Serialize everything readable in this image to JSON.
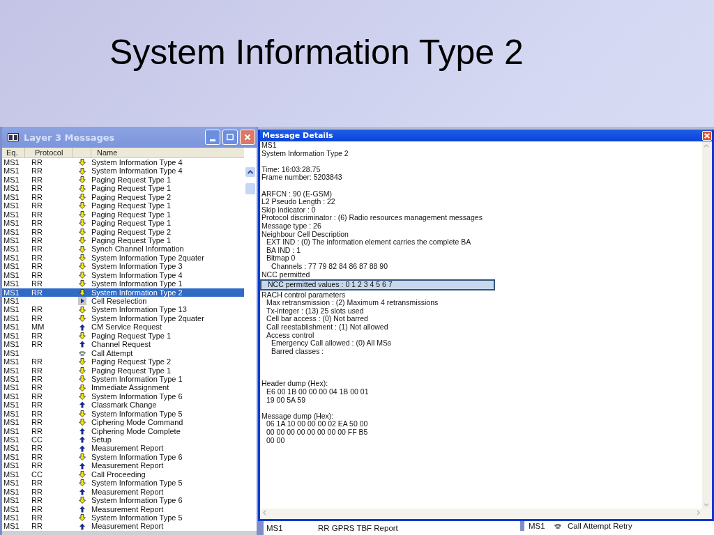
{
  "slide_title": "System Information Type 2",
  "messages_window": {
    "title": "Layer 3 Messages",
    "columns": [
      "Eq.",
      "Protocol",
      "Name"
    ],
    "rows": [
      {
        "eq": "MS1",
        "protocol": "RR",
        "kind": "down",
        "name": "System Information Type 4",
        "selected": false
      },
      {
        "eq": "MS1",
        "protocol": "RR",
        "kind": "down",
        "name": "System Information Type 4",
        "selected": false
      },
      {
        "eq": "MS1",
        "protocol": "RR",
        "kind": "down",
        "name": "Paging Request Type 1",
        "selected": false
      },
      {
        "eq": "MS1",
        "protocol": "RR",
        "kind": "down",
        "name": "Paging Request Type 1",
        "selected": false
      },
      {
        "eq": "MS1",
        "protocol": "RR",
        "kind": "down",
        "name": "Paging Request Type 2",
        "selected": false
      },
      {
        "eq": "MS1",
        "protocol": "RR",
        "kind": "down",
        "name": "Paging Request Type 1",
        "selected": false
      },
      {
        "eq": "MS1",
        "protocol": "RR",
        "kind": "down",
        "name": "Paging Request Type 1",
        "selected": false
      },
      {
        "eq": "MS1",
        "protocol": "RR",
        "kind": "down",
        "name": "Paging Request Type 1",
        "selected": false
      },
      {
        "eq": "MS1",
        "protocol": "RR",
        "kind": "down",
        "name": "Paging Request Type 2",
        "selected": false
      },
      {
        "eq": "MS1",
        "protocol": "RR",
        "kind": "down",
        "name": "Paging Request Type 1",
        "selected": false
      },
      {
        "eq": "MS1",
        "protocol": "RR",
        "kind": "down",
        "name": "Synch Channel Information",
        "selected": false
      },
      {
        "eq": "MS1",
        "protocol": "RR",
        "kind": "down",
        "name": "System Information Type 2quater",
        "selected": false
      },
      {
        "eq": "MS1",
        "protocol": "RR",
        "kind": "down",
        "name": "System Information Type 3",
        "selected": false
      },
      {
        "eq": "MS1",
        "protocol": "RR",
        "kind": "down",
        "name": "System Information Type 4",
        "selected": false
      },
      {
        "eq": "MS1",
        "protocol": "RR",
        "kind": "down",
        "name": "System Information Type 1",
        "selected": false
      },
      {
        "eq": "MS1",
        "protocol": "RR",
        "kind": "down",
        "name": "System Information Type 2",
        "selected": true
      },
      {
        "eq": "MS1",
        "kind": "event",
        "name": "Cell Reselection",
        "selected": false
      },
      {
        "eq": "MS1",
        "protocol": "RR",
        "kind": "down",
        "name": "System Information Type 13",
        "selected": false
      },
      {
        "eq": "MS1",
        "protocol": "RR",
        "kind": "down",
        "name": "System Information Type 2quater",
        "selected": false
      },
      {
        "eq": "MS1",
        "protocol": "MM",
        "kind": "up",
        "name": "CM Service Request",
        "selected": false
      },
      {
        "eq": "MS1",
        "protocol": "RR",
        "kind": "down",
        "name": "Paging Request Type 1",
        "selected": false
      },
      {
        "eq": "MS1",
        "protocol": "RR",
        "kind": "up",
        "name": "Channel Request",
        "selected": false
      },
      {
        "eq": "MS1",
        "kind": "call",
        "name": "Call Attempt",
        "selected": false
      },
      {
        "eq": "MS1",
        "protocol": "RR",
        "kind": "down",
        "name": "Paging Request Type 2",
        "selected": false
      },
      {
        "eq": "MS1",
        "protocol": "RR",
        "kind": "down",
        "name": "Paging Request Type 1",
        "selected": false
      },
      {
        "eq": "MS1",
        "protocol": "RR",
        "kind": "down",
        "name": "System Information Type 1",
        "selected": false
      },
      {
        "eq": "MS1",
        "protocol": "RR",
        "kind": "down",
        "name": "Immediate Assignment",
        "selected": false
      },
      {
        "eq": "MS1",
        "protocol": "RR",
        "kind": "down",
        "name": "System Information Type 6",
        "selected": false
      },
      {
        "eq": "MS1",
        "protocol": "RR",
        "kind": "up",
        "name": "Classmark Change",
        "selected": false
      },
      {
        "eq": "MS1",
        "protocol": "RR",
        "kind": "down",
        "name": "System Information Type 5",
        "selected": false
      },
      {
        "eq": "MS1",
        "protocol": "RR",
        "kind": "down",
        "name": "Ciphering Mode Command",
        "selected": false
      },
      {
        "eq": "MS1",
        "protocol": "RR",
        "kind": "up",
        "name": "Ciphering Mode Complete",
        "selected": false
      },
      {
        "eq": "MS1",
        "protocol": "CC",
        "kind": "up",
        "name": "Setup",
        "selected": false
      },
      {
        "eq": "MS1",
        "protocol": "RR",
        "kind": "up",
        "name": "Measurement Report",
        "selected": false
      },
      {
        "eq": "MS1",
        "protocol": "RR",
        "kind": "down",
        "name": "System Information Type 6",
        "selected": false
      },
      {
        "eq": "MS1",
        "protocol": "RR",
        "kind": "up",
        "name": "Measurement Report",
        "selected": false
      },
      {
        "eq": "MS1",
        "protocol": "CC",
        "kind": "down",
        "name": "Call Proceeding",
        "selected": false
      },
      {
        "eq": "MS1",
        "protocol": "RR",
        "kind": "down",
        "name": "System Information Type 5",
        "selected": false
      },
      {
        "eq": "MS1",
        "protocol": "RR",
        "kind": "up",
        "name": "Measurement Report",
        "selected": false
      },
      {
        "eq": "MS1",
        "protocol": "RR",
        "kind": "down",
        "name": "System Information Type 6",
        "selected": false
      },
      {
        "eq": "MS1",
        "protocol": "RR",
        "kind": "up",
        "name": "Measurement Report",
        "selected": false
      },
      {
        "eq": "MS1",
        "protocol": "RR",
        "kind": "down",
        "name": "System Information Type 5",
        "selected": false
      },
      {
        "eq": "MS1",
        "protocol": "RR",
        "kind": "up",
        "name": "Measurement Report",
        "selected": false
      }
    ]
  },
  "details_window": {
    "title": "Message Details",
    "groups": [
      {
        "items": [
          {
            "text": "MS1",
            "selected": false
          },
          {
            "text": "System Information Type 2",
            "selected": false
          }
        ]
      },
      {
        "items": [
          {
            "text": "Time: 16:03:28.75",
            "selected": false
          },
          {
            "text": "Frame number: 5203843",
            "selected": false
          }
        ]
      },
      {
        "items": [
          {
            "text": "ARFCN : 90 (E-GSM)",
            "selected": false
          },
          {
            "text": "L2 Pseudo Length : 22",
            "selected": false
          },
          {
            "text": "Skip indicator : 0",
            "selected": false
          },
          {
            "text": "Protocol discriminator : (6) Radio resources management messages",
            "selected": false
          },
          {
            "text": "Message type : 26",
            "selected": false
          },
          {
            "text": "Neighbour Cell Description",
            "selected": false,
            "children": [
              {
                "text": "EXT IND : (0) The information element carries the complete BA",
                "selected": false
              },
              {
                "text": "BA IND : 1",
                "selected": false
              },
              {
                "text": "Bitmap 0",
                "selected": false,
                "children": [
                  {
                    "text": "Channels : 77 79 82 84 86 87 88 90",
                    "selected": false
                  }
                ]
              }
            ]
          },
          {
            "text": "NCC permitted",
            "selected": false,
            "children": [
              {
                "text": "NCC permitted values : 0 1 2 3 4 5 6 7",
                "selected": true
              }
            ]
          },
          {
            "text": "RACH control parameters",
            "selected": false,
            "children": [
              {
                "text": "Max retransmission : (2) Maximum 4 retransmissions",
                "selected": false
              },
              {
                "text": "Tx-integer : (13) 25 slots used",
                "selected": false
              },
              {
                "text": "Cell bar access : (0) Not barred",
                "selected": false
              },
              {
                "text": "Call reestablishment : (1) Not allowed",
                "selected": false
              },
              {
                "text": "Access control",
                "selected": false,
                "children": [
                  {
                    "text": "Emergency Call allowed : (0) All MSs",
                    "selected": false
                  },
                  {
                    "text": "Barred classes :",
                    "selected": false
                  }
                ]
              }
            ]
          }
        ]
      },
      {
        "items": [
          {
            "text": "Header dump (Hex):",
            "selected": false,
            "children": [
              {
                "text": "E6 00 1B 00 00 00 04 1B 00 01",
                "selected": false
              },
              {
                "text": "19 00 5A 59",
                "selected": false
              }
            ]
          }
        ]
      },
      {
        "items": [
          {
            "text": "Message dump (Hex):",
            "selected": false,
            "children": [
              {
                "text": "06 1A 10 00 00 00 02 EA 50 00",
                "selected": false
              },
              {
                "text": "00 00 00 00 00 00 00 00 FF B5",
                "selected": false
              },
              {
                "text": "00 00",
                "selected": false
              }
            ]
          }
        ]
      }
    ]
  },
  "background_rows": [
    {
      "eq": "MS1",
      "kind": "text",
      "name": "RR GPRS TBF Report"
    },
    {
      "eq": "MS1",
      "kind": "call",
      "name": "Call Attempt Retry"
    }
  ]
}
